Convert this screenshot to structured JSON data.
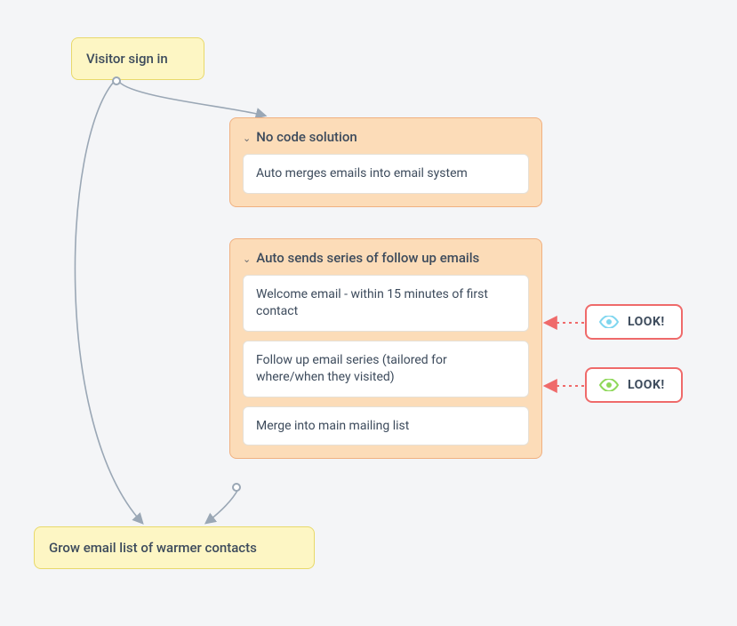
{
  "nodes": {
    "visitor": "Visitor sign in",
    "grow": "Grow email list of warmer contacts"
  },
  "group1": {
    "title": "No code solution",
    "items": [
      "Auto merges emails into email system"
    ]
  },
  "group2": {
    "title": "Auto sends series of follow up emails",
    "items": [
      "Welcome email - within 15 minutes of first contact",
      "Follow up email series (tailored for where/when they visited)",
      "Merge into main mailing list"
    ]
  },
  "callouts": {
    "look1": "LOOK!",
    "look2": "LOOK!"
  },
  "colors": {
    "yellow_bg": "#fdf6c4",
    "yellow_border": "#e8d96a",
    "orange_bg": "#fcdcb8",
    "orange_border": "#f0b080",
    "red": "#ef6a6a",
    "arrow": "#9aa7b5",
    "eye_blue": "#7fd6ef",
    "eye_green": "#8fd85a"
  }
}
